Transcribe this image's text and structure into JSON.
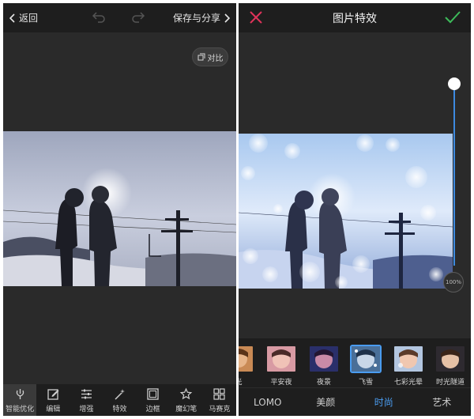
{
  "left": {
    "back_label": "返回",
    "save_label": "保存与分享",
    "compare_label": "对比",
    "tools": [
      {
        "label": "智能优化",
        "icon": "smart-optimize-icon",
        "active": true
      },
      {
        "label": "编辑",
        "icon": "edit-icon"
      },
      {
        "label": "增强",
        "icon": "adjust-sliders-icon"
      },
      {
        "label": "特效",
        "icon": "magic-wand-icon"
      },
      {
        "label": "边框",
        "icon": "frame-icon"
      },
      {
        "label": "魔幻笔",
        "icon": "magic-pen-icon"
      },
      {
        "label": "马赛克",
        "icon": "mosaic-icon"
      }
    ]
  },
  "right": {
    "title": "图片特效",
    "intensity_label": "100%",
    "filters": [
      "光",
      "平安夜",
      "夜景",
      "飞雪",
      "七彩光晕",
      "时光隧道"
    ],
    "selected_filter": "飞雪",
    "categories": [
      "LOMO",
      "美颜",
      "时尚",
      "艺术"
    ],
    "active_category": "时尚",
    "colors": {
      "accent": "#4a9cf0",
      "cancel": "#e0335a",
      "confirm": "#3dbb5a"
    }
  }
}
